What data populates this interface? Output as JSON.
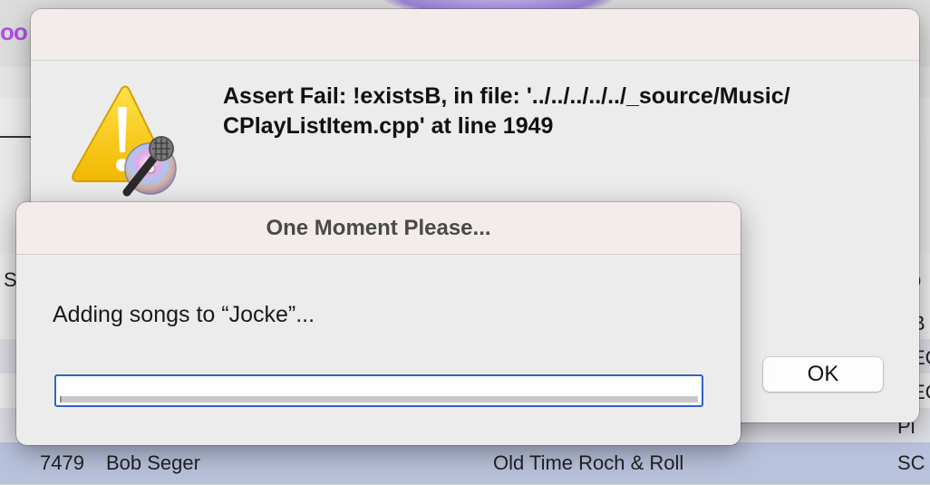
{
  "background_app": {
    "logo_fragment": "oo",
    "header_fragment_left": "S",
    "header_fragment_right": "o",
    "right_fragments": [
      "B",
      "EC",
      "EC",
      "Pi"
    ],
    "selected_row": {
      "number": "7479",
      "artist": "Bob Seger",
      "title": "Old Time Roch & Roll",
      "right_fragment": "SC"
    }
  },
  "assert_dialog": {
    "message_line1": "Assert Fail: !existsB, in file: '../../../../../_source/Music/",
    "message_line2": "CPlayListItem.cpp' at line 1949",
    "icon": "warning-triangle-with-microphone-icon",
    "ok_label": "OK"
  },
  "progress_dialog": {
    "title": "One Moment Please...",
    "message": "Adding songs to “Jocke”...",
    "progress": 0
  },
  "colors": {
    "accent": "#2f62c6",
    "warning_yellow": "#f6c700",
    "selection": "#b9c2dc",
    "logo_purple": "#b04fe8"
  }
}
